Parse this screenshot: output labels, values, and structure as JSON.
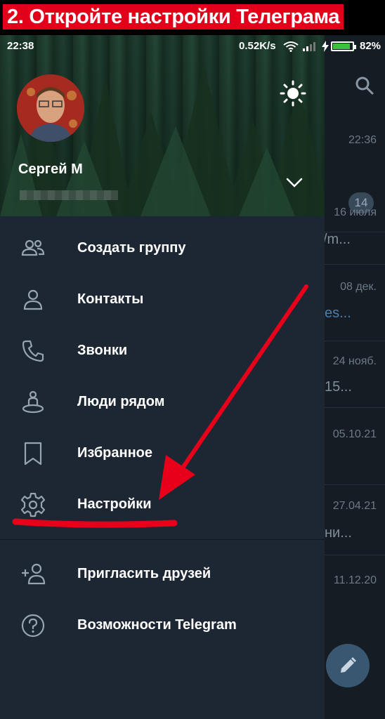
{
  "caption": "2. Откройте настройки Телеграма",
  "status_bar": {
    "time": "22:38",
    "network_speed": "0.52K/s",
    "battery": "82%"
  },
  "drawer": {
    "user_name": "Сергей М",
    "menu": [
      {
        "label": "Создать группу",
        "icon": "group-icon"
      },
      {
        "label": "Контакты",
        "icon": "contact-icon"
      },
      {
        "label": "Звонки",
        "icon": "phone-icon"
      },
      {
        "label": "Люди рядом",
        "icon": "people-nearby-icon"
      },
      {
        "label": "Избранное",
        "icon": "bookmark-icon"
      },
      {
        "label": "Настройки",
        "icon": "gear-icon"
      }
    ],
    "secondary_menu": [
      {
        "label": "Пригласить друзей",
        "icon": "add-user-icon"
      },
      {
        "label": "Возможности Telegram",
        "icon": "help-icon"
      }
    ]
  },
  "chat_list": {
    "items": [
      {
        "date": "22:36",
        "badge": "14"
      },
      {
        "date": "16 июля",
        "snippet": "/m..."
      },
      {
        "date": "08 дек.",
        "snippet": "es..."
      },
      {
        "date": "24 нояб.",
        "snippet": "15..."
      },
      {
        "date": "05.10.21"
      },
      {
        "date": "27.04.21",
        "snippet": "ни..."
      },
      {
        "date": "11.12.20"
      }
    ]
  },
  "colors": {
    "accent_red": "#e3001b",
    "drawer_bg": "#1d2733",
    "battery_green": "#3ec03a"
  }
}
